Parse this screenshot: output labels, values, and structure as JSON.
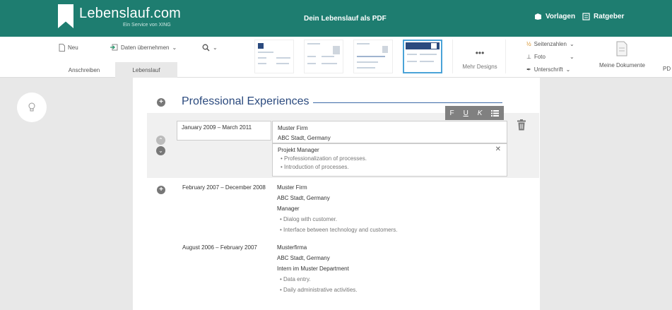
{
  "header": {
    "logo": "Lebenslauf.com",
    "logo_sub": "Ein Service von XING",
    "title": "Dein Lebenslauf als PDF",
    "nav": [
      "Vorlagen",
      "Ratgeber"
    ]
  },
  "toolbar": {
    "new": "Neu",
    "import": "Daten übernehmen",
    "zoom_icon": "zoom-icon",
    "tabs": [
      "Anschreiben",
      "Lebenslauf"
    ],
    "more_designs": "Mehr Designs",
    "more_dots": "•••",
    "options": [
      "Seitenzahlen",
      "Foto",
      "Unterschrift"
    ],
    "my_documents": "Meine Dokumente",
    "pdf_cut": "PD"
  },
  "section": {
    "title": "Professional Experiences"
  },
  "format_bar": {
    "bold": "F",
    "underline": "U",
    "italic": "K",
    "list": "list-icon"
  },
  "entries": [
    {
      "date": "January 2009 – March 2011",
      "firm": "Muster Firm",
      "location": "ABC Stadt, Germany",
      "role": "Projekt Manager",
      "bullets": [
        "Professionalization of processes.",
        "Introduction of processes."
      ]
    },
    {
      "date": "February 2007 – December 2008",
      "firm": "Muster Firm",
      "location": "ABC Stadt, Germany",
      "role": "Manager",
      "bullets": [
        "Dialog with customer.",
        "Interface between technology and customers."
      ]
    },
    {
      "date": "August 2006 – February 2007",
      "firm": "Musterfirma",
      "location": "ABC Stadt, Germany",
      "role": "Intern im Muster Department",
      "bullets": [
        "Data entry.",
        "Daily administrative activities."
      ]
    }
  ],
  "colors": {
    "brand": "#1e7d70",
    "heading": "#2b4a7e",
    "selected": "#4aa3d8"
  }
}
